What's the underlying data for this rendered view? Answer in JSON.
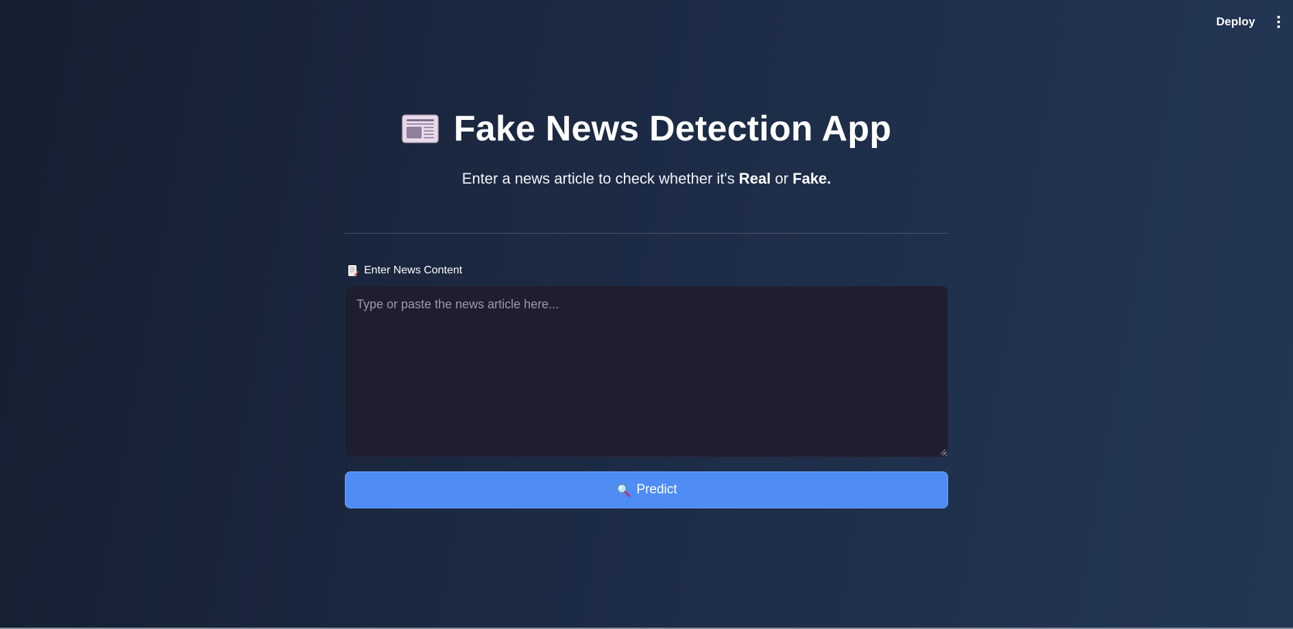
{
  "header": {
    "deploy_label": "Deploy",
    "menu_icon": "kebab-menu-icon"
  },
  "main": {
    "title_icon": "newspaper-icon",
    "title": "Fake News Detection App",
    "subtitle": {
      "prefix": "Enter a news article to check whether it's ",
      "real": "Real",
      "connector": " or ",
      "fake": "Fake",
      "suffix": "."
    },
    "input": {
      "label_icon": "memo-icon",
      "label": "Enter News Content",
      "placeholder": "Type or paste the news article here...",
      "value": ""
    },
    "predict_button": {
      "icon": "magnifying-glass-icon",
      "label": "Predict"
    }
  },
  "colors": {
    "background_start": "#161f31",
    "background_end": "#233755",
    "textarea_bg": "#1f1e2f",
    "button_accent": "#4f8df5"
  }
}
